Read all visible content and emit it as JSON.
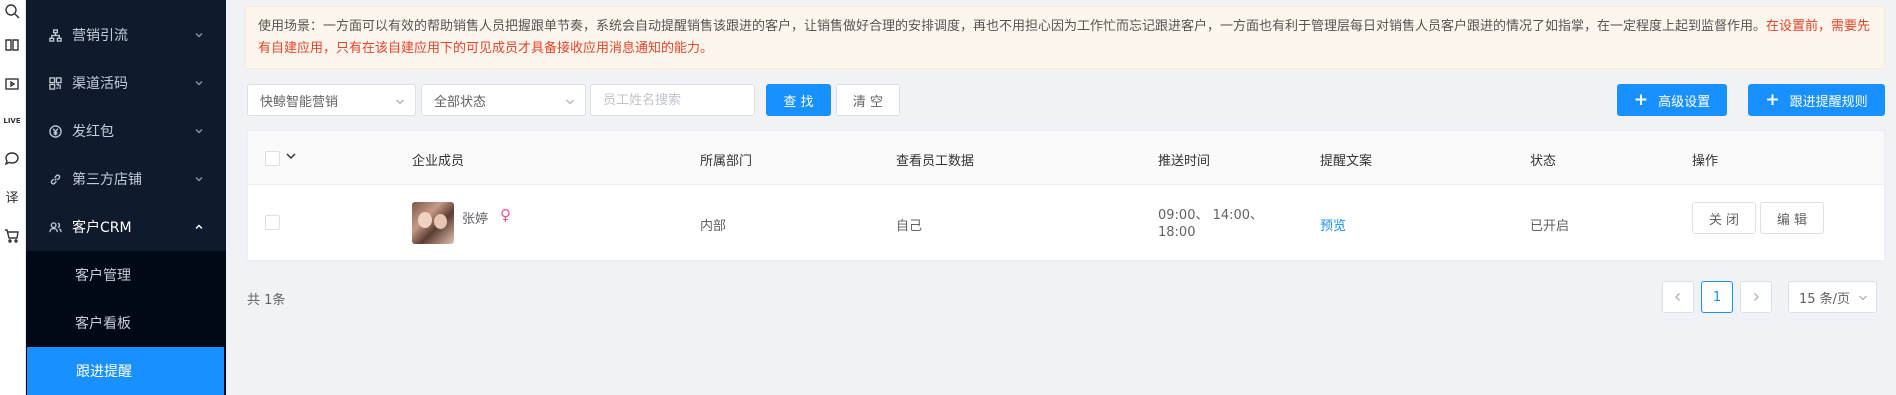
{
  "rail": {
    "icons": [
      "search-icon",
      "book-icon",
      "video-icon",
      "live-icon",
      "chat-icon",
      "translate-icon",
      "cart-icon"
    ],
    "live_text": "LIVE",
    "translate_text": "译"
  },
  "sidebar": {
    "items": [
      {
        "label": "营销引流",
        "icon": "sitemap-icon"
      },
      {
        "label": "渠道活码",
        "icon": "qrcode-icon"
      },
      {
        "label": "发红包",
        "icon": "yen-icon"
      },
      {
        "label": "第三方店铺",
        "icon": "link-icon"
      },
      {
        "label": "客户CRM",
        "icon": "users-icon"
      }
    ],
    "subitems": [
      {
        "label": "客户管理"
      },
      {
        "label": "客户看板"
      },
      {
        "label": "跟进提醒"
      }
    ]
  },
  "notice": {
    "text": "使用场景：一方面可以有效的帮助销售人员把握跟单节奏，系统会自动提醒销售该跟进的客户，让销售做好合理的安排调度，再也不用担心因为工作忙而忘记跟进客户，一方面也有利于管理层每日对销售人员客户跟进的情况了如指掌，在一定程度上起到监督作用。",
    "warning": "在设置前，需要先有自建应用，只有在该自建应用下的可见成员才具备接收应用消息通知的能力。"
  },
  "filters": {
    "app_select": "快鲸智能营销",
    "status_select": "全部状态",
    "search_placeholder": "员工姓名搜索",
    "search_button": "查 找",
    "clear_button": "清 空",
    "advanced_button": "高级设置",
    "rule_button": "跟进提醒规则"
  },
  "table": {
    "headers": [
      "企业成员",
      "所属部门",
      "查看员工数据",
      "推送时间",
      "提醒文案",
      "状态",
      "操作"
    ],
    "rows": [
      {
        "name": "张婷",
        "gender_symbol": "♀",
        "department": "内部",
        "data_scope": "自己",
        "push_time_line1": "09:00、 14:00、",
        "push_time_line2": "18:00",
        "copy_link": "预览",
        "status": "已开启",
        "close_button": "关 闭",
        "edit_button": "编 辑"
      }
    ]
  },
  "pagination": {
    "total": "共 1条",
    "current_page": "1",
    "page_size": "15 条/页"
  },
  "colors": {
    "primary": "#1890ff",
    "sidebar_bg": "#0f1b2d",
    "warning_text": "#e6442b",
    "female_icon": "#f0529c"
  }
}
